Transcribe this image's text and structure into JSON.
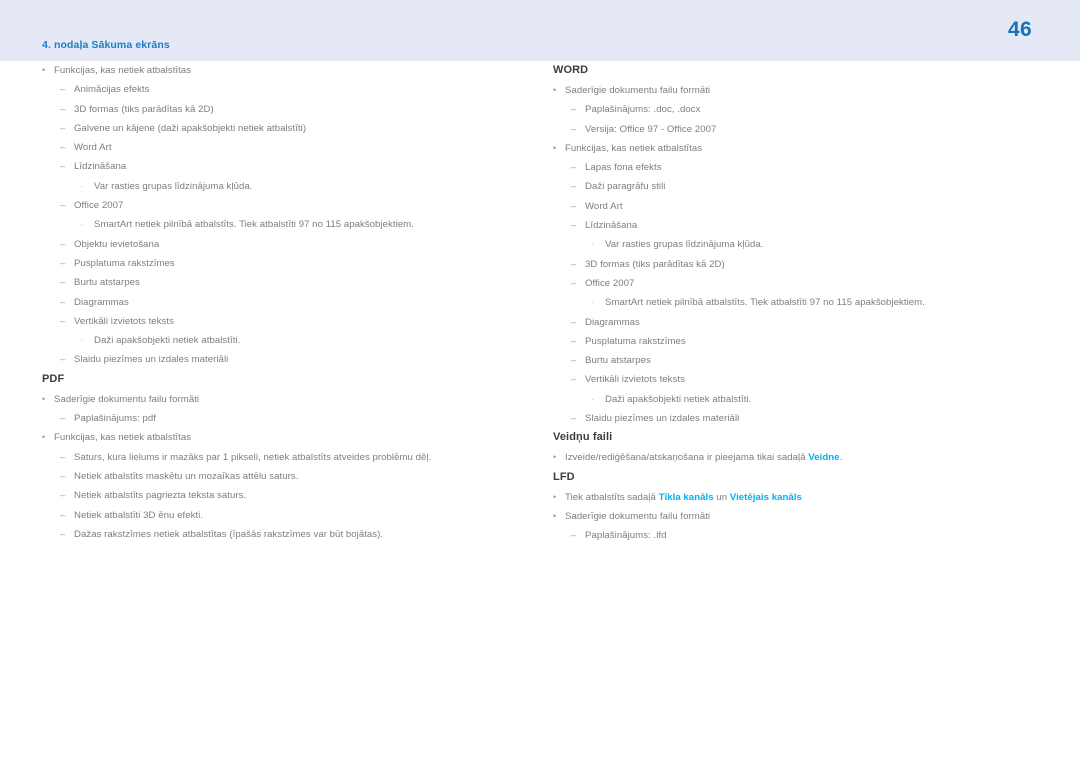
{
  "header": {
    "chapter": "4. nodaļa Sākuma ekrāns",
    "page_number": "46",
    "band_color": "#e4e9f5",
    "chapter_color": "#1a7ec8",
    "page_number_color": "#1473bd"
  },
  "theme": {
    "link_color": "#00b0f0",
    "body_text_color": "#7e7e7e",
    "heading_color": "#3c3c3c",
    "page_background": "#ffffff"
  },
  "markers": {
    "level1": "•",
    "level2": "–",
    "level3": "·"
  },
  "left_column": {
    "sections": [
      {
        "title": "",
        "items": [
          {
            "level": 1,
            "text": "Funkcijas, kas netiek atbalstītas"
          },
          {
            "level": 2,
            "text": "Animācijas efekts"
          },
          {
            "level": 2,
            "text": "3D formas (tiks parādītas kā 2D)"
          },
          {
            "level": 2,
            "text": "Galvene un kājene (daži apakšobjekti netiek atbalstīti)"
          },
          {
            "level": 2,
            "text": "Word Art"
          },
          {
            "level": 2,
            "text": "Līdzināšana"
          },
          {
            "level": 3,
            "text": "Var rasties grupas līdzinājuma kļūda."
          },
          {
            "level": 2,
            "text": "Office 2007"
          },
          {
            "level": 3,
            "text": "SmartArt netiek pilnībā atbalstīts. Tiek atbalstīti 97 no 115 apakšobjektiem."
          },
          {
            "level": 2,
            "text": "Objektu ievietošana"
          },
          {
            "level": 2,
            "text": "Pusplatuma rakstzīmes"
          },
          {
            "level": 2,
            "text": "Burtu atstarpes"
          },
          {
            "level": 2,
            "text": "Diagrammas"
          },
          {
            "level": 2,
            "text": "Vertikāli izvietots teksts"
          },
          {
            "level": 3,
            "text": "Daži apakšobjekti netiek atbalstīti."
          },
          {
            "level": 2,
            "text": "Slaidu piezīmes un izdales materiāli"
          }
        ]
      },
      {
        "title": "PDF",
        "items": [
          {
            "level": 1,
            "text": "Saderīgie dokumentu failu formāti"
          },
          {
            "level": 2,
            "text": "Paplašinājums: pdf"
          },
          {
            "level": 1,
            "text": "Funkcijas, kas netiek atbalstītas"
          },
          {
            "level": 2,
            "text": "Saturs, kura lielums ir mazāks par 1 pikseli, netiek atbalstīts atveides problēmu dēļ."
          },
          {
            "level": 2,
            "text": "Netiek atbalstīts maskētu un mozaīkas attēlu saturs."
          },
          {
            "level": 2,
            "text": "Netiek atbalstīts pagriezta teksta saturs."
          },
          {
            "level": 2,
            "text": "Netiek atbalstīti 3D ēnu efekti."
          },
          {
            "level": 2,
            "text": "Dažas rakstzīmes netiek atbalstītas (īpašās rakstzīmes var būt bojātas)."
          }
        ]
      }
    ]
  },
  "right_column": {
    "sections": [
      {
        "title": "WORD",
        "items": [
          {
            "level": 1,
            "text": "Saderīgie dokumentu failu formāti"
          },
          {
            "level": 2,
            "text": "Paplašinājums: .doc, .docx"
          },
          {
            "level": 2,
            "text": "Versija: Office 97 - Office 2007"
          },
          {
            "level": 1,
            "text": "Funkcijas, kas netiek atbalstītas"
          },
          {
            "level": 2,
            "text": "Lapas fona efekts"
          },
          {
            "level": 2,
            "text": "Daži paragrāfu stili"
          },
          {
            "level": 2,
            "text": "Word Art"
          },
          {
            "level": 2,
            "text": "Līdzināšana"
          },
          {
            "level": 3,
            "text": "Var rasties grupas līdzinājuma kļūda."
          },
          {
            "level": 2,
            "text": "3D formas (tiks parādītas kā 2D)"
          },
          {
            "level": 2,
            "text": "Office 2007"
          },
          {
            "level": 3,
            "text": "SmartArt netiek pilnībā atbalstīts. Tiek atbalstīti 97 no 115 apakšobjektiem."
          },
          {
            "level": 2,
            "text": "Diagrammas"
          },
          {
            "level": 2,
            "text": "Pusplatuma rakstzīmes"
          },
          {
            "level": 2,
            "text": "Burtu atstarpes"
          },
          {
            "level": 2,
            "text": "Vertikāli izvietots teksts"
          },
          {
            "level": 3,
            "text": "Daži apakšobjekti netiek atbalstīti."
          },
          {
            "level": 2,
            "text": "Slaidu piezīmes un izdales materiāli"
          }
        ]
      },
      {
        "title": "Veidņu faili",
        "items": [
          {
            "level": 1,
            "runs": [
              {
                "text": "Izveide/rediģēšana/atskaņošana ir pieejama tikai sadaļā ",
                "style": "plain"
              },
              {
                "text": "Veidne",
                "style": "link"
              },
              {
                "text": ".",
                "style": "plain"
              }
            ]
          }
        ]
      },
      {
        "title": "LFD",
        "items": [
          {
            "level": 1,
            "runs": [
              {
                "text": "Tiek atbalstīts sadaļā ",
                "style": "plain"
              },
              {
                "text": "Tīkla kanāls",
                "style": "link"
              },
              {
                "text": " un ",
                "style": "plain"
              },
              {
                "text": "Vietējais kanāls",
                "style": "link"
              }
            ]
          },
          {
            "level": 1,
            "text": "Saderīgie dokumentu failu formāti"
          },
          {
            "level": 2,
            "text": "Paplašinājums: .lfd"
          }
        ]
      }
    ]
  }
}
